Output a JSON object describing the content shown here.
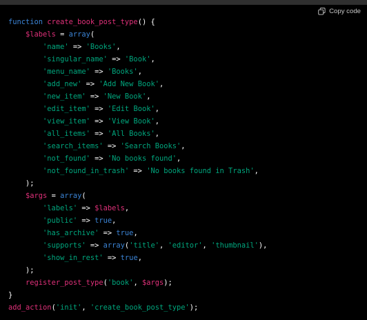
{
  "toolbar": {
    "copy_label": "Copy code"
  },
  "code": {
    "lines": [
      [
        {
          "t": "function",
          "c": "kw"
        },
        {
          "t": " ",
          "c": ""
        },
        {
          "t": "create_book_post_type",
          "c": "fn"
        },
        {
          "t": "() {",
          "c": "punc"
        }
      ],
      [
        {
          "t": "    ",
          "c": ""
        },
        {
          "t": "$labels",
          "c": "var"
        },
        {
          "t": " = ",
          "c": "op"
        },
        {
          "t": "array",
          "c": "builtin"
        },
        {
          "t": "(",
          "c": "punc"
        }
      ],
      [
        {
          "t": "        ",
          "c": ""
        },
        {
          "t": "'name'",
          "c": "str"
        },
        {
          "t": " => ",
          "c": "op"
        },
        {
          "t": "'Books'",
          "c": "str"
        },
        {
          "t": ",",
          "c": "punc"
        }
      ],
      [
        {
          "t": "        ",
          "c": ""
        },
        {
          "t": "'singular_name'",
          "c": "str"
        },
        {
          "t": " => ",
          "c": "op"
        },
        {
          "t": "'Book'",
          "c": "str"
        },
        {
          "t": ",",
          "c": "punc"
        }
      ],
      [
        {
          "t": "        ",
          "c": ""
        },
        {
          "t": "'menu_name'",
          "c": "str"
        },
        {
          "t": " => ",
          "c": "op"
        },
        {
          "t": "'Books'",
          "c": "str"
        },
        {
          "t": ",",
          "c": "punc"
        }
      ],
      [
        {
          "t": "        ",
          "c": ""
        },
        {
          "t": "'add_new'",
          "c": "str"
        },
        {
          "t": " => ",
          "c": "op"
        },
        {
          "t": "'Add New Book'",
          "c": "str"
        },
        {
          "t": ",",
          "c": "punc"
        }
      ],
      [
        {
          "t": "        ",
          "c": ""
        },
        {
          "t": "'new_item'",
          "c": "str"
        },
        {
          "t": " => ",
          "c": "op"
        },
        {
          "t": "'New Book'",
          "c": "str"
        },
        {
          "t": ",",
          "c": "punc"
        }
      ],
      [
        {
          "t": "        ",
          "c": ""
        },
        {
          "t": "'edit_item'",
          "c": "str"
        },
        {
          "t": " => ",
          "c": "op"
        },
        {
          "t": "'Edit Book'",
          "c": "str"
        },
        {
          "t": ",",
          "c": "punc"
        }
      ],
      [
        {
          "t": "        ",
          "c": ""
        },
        {
          "t": "'view_item'",
          "c": "str"
        },
        {
          "t": " => ",
          "c": "op"
        },
        {
          "t": "'View Book'",
          "c": "str"
        },
        {
          "t": ",",
          "c": "punc"
        }
      ],
      [
        {
          "t": "        ",
          "c": ""
        },
        {
          "t": "'all_items'",
          "c": "str"
        },
        {
          "t": " => ",
          "c": "op"
        },
        {
          "t": "'All Books'",
          "c": "str"
        },
        {
          "t": ",",
          "c": "punc"
        }
      ],
      [
        {
          "t": "        ",
          "c": ""
        },
        {
          "t": "'search_items'",
          "c": "str"
        },
        {
          "t": " => ",
          "c": "op"
        },
        {
          "t": "'Search Books'",
          "c": "str"
        },
        {
          "t": ",",
          "c": "punc"
        }
      ],
      [
        {
          "t": "        ",
          "c": ""
        },
        {
          "t": "'not_found'",
          "c": "str"
        },
        {
          "t": " => ",
          "c": "op"
        },
        {
          "t": "'No books found'",
          "c": "str"
        },
        {
          "t": ",",
          "c": "punc"
        }
      ],
      [
        {
          "t": "        ",
          "c": ""
        },
        {
          "t": "'not_found_in_trash'",
          "c": "str"
        },
        {
          "t": " => ",
          "c": "op"
        },
        {
          "t": "'No books found in Trash'",
          "c": "str"
        },
        {
          "t": ",",
          "c": "punc"
        }
      ],
      [
        {
          "t": "    ",
          "c": ""
        },
        {
          "t": ");",
          "c": "punc"
        }
      ],
      [
        {
          "t": "    ",
          "c": ""
        },
        {
          "t": "$args",
          "c": "var"
        },
        {
          "t": " = ",
          "c": "op"
        },
        {
          "t": "array",
          "c": "builtin"
        },
        {
          "t": "(",
          "c": "punc"
        }
      ],
      [
        {
          "t": "        ",
          "c": ""
        },
        {
          "t": "'labels'",
          "c": "str"
        },
        {
          "t": " => ",
          "c": "op"
        },
        {
          "t": "$labels",
          "c": "var"
        },
        {
          "t": ",",
          "c": "punc"
        }
      ],
      [
        {
          "t": "        ",
          "c": ""
        },
        {
          "t": "'public'",
          "c": "str"
        },
        {
          "t": " => ",
          "c": "op"
        },
        {
          "t": "true",
          "c": "bool"
        },
        {
          "t": ",",
          "c": "punc"
        }
      ],
      [
        {
          "t": "        ",
          "c": ""
        },
        {
          "t": "'has_archive'",
          "c": "str"
        },
        {
          "t": " => ",
          "c": "op"
        },
        {
          "t": "true",
          "c": "bool"
        },
        {
          "t": ",",
          "c": "punc"
        }
      ],
      [
        {
          "t": "        ",
          "c": ""
        },
        {
          "t": "'supports'",
          "c": "str"
        },
        {
          "t": " => ",
          "c": "op"
        },
        {
          "t": "array",
          "c": "builtin"
        },
        {
          "t": "(",
          "c": "punc"
        },
        {
          "t": "'title'",
          "c": "str"
        },
        {
          "t": ", ",
          "c": "punc"
        },
        {
          "t": "'editor'",
          "c": "str"
        },
        {
          "t": ", ",
          "c": "punc"
        },
        {
          "t": "'thumbnail'",
          "c": "str"
        },
        {
          "t": "),",
          "c": "punc"
        }
      ],
      [
        {
          "t": "        ",
          "c": ""
        },
        {
          "t": "'show_in_rest'",
          "c": "str"
        },
        {
          "t": " => ",
          "c": "op"
        },
        {
          "t": "true",
          "c": "bool"
        },
        {
          "t": ",",
          "c": "punc"
        }
      ],
      [
        {
          "t": "    ",
          "c": ""
        },
        {
          "t": ");",
          "c": "punc"
        }
      ],
      [
        {
          "t": "    ",
          "c": ""
        },
        {
          "t": "register_post_type",
          "c": "fn"
        },
        {
          "t": "(",
          "c": "punc"
        },
        {
          "t": "'book'",
          "c": "str"
        },
        {
          "t": ", ",
          "c": "punc"
        },
        {
          "t": "$args",
          "c": "var"
        },
        {
          "t": ");",
          "c": "punc"
        }
      ],
      [
        {
          "t": "}",
          "c": "punc"
        }
      ],
      [
        {
          "t": "add_action",
          "c": "fn"
        },
        {
          "t": "(",
          "c": "punc"
        },
        {
          "t": "'init'",
          "c": "str"
        },
        {
          "t": ", ",
          "c": "punc"
        },
        {
          "t": "'create_book_post_type'",
          "c": "str"
        },
        {
          "t": ");",
          "c": "punc"
        }
      ]
    ]
  }
}
